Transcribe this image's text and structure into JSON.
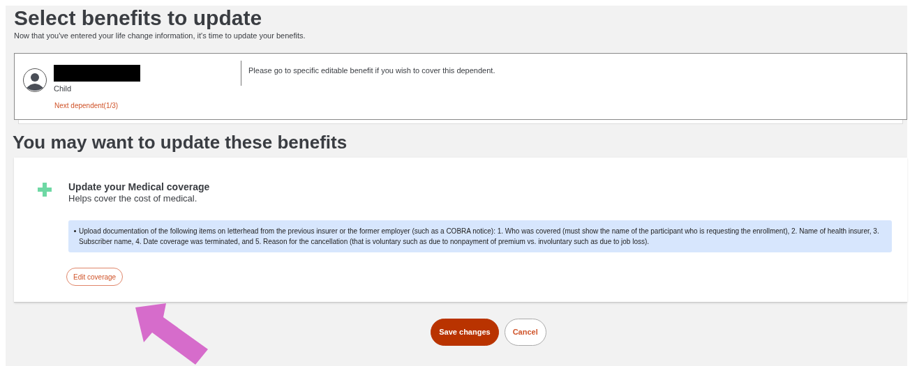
{
  "page_title": "Select benefits to update",
  "page_subtitle": "Now that you've entered your life change information, it's time to update your benefits.",
  "dependent": {
    "relationship": "Child",
    "next_link": "Next dependent(1/3)",
    "message": "Please go to specific editable benefit if you wish to cover this dependent."
  },
  "section_title": "You may want to update these benefits",
  "benefit": {
    "title": "Update your Medical coverage",
    "subtitle": "Helps cover the cost of medical.",
    "notes": [
      "Upload documentation of the following items on letterhead from the previous insurer or the former employer (such as a COBRA notice): 1. Who was covered (must show the name of the participant who is requesting the enrollment), 2. Name of health insurer, 3. Subscriber name, 4. Date coverage was terminated, and 5. Reason for the cancellation (that is voluntary such as due to nonpayment of premium vs. involuntary such as due to job loss)."
    ],
    "edit_button": "Edit coverage"
  },
  "buttons": [
    {
      "label": "Save changes",
      "kind": "primary"
    },
    {
      "label": "Cancel",
      "kind": "secondary"
    }
  ]
}
